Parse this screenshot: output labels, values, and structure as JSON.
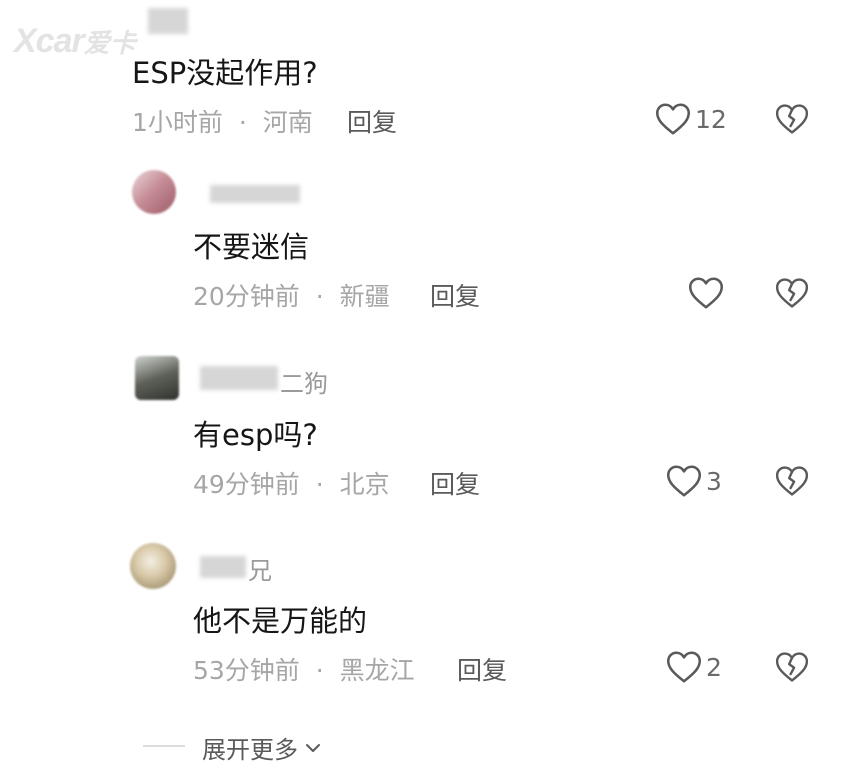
{
  "watermark": {
    "brand": "Xcar",
    "sub": "爱卡"
  },
  "top_comment": {
    "text": "ESP没起作用?",
    "time": "1小时前",
    "location": "河南",
    "reply_label": "回复",
    "likes": "12"
  },
  "replies": [
    {
      "username": "",
      "text": "不要迷信",
      "time": "20分钟前",
      "location": "新疆",
      "reply_label": "回复",
      "likes": ""
    },
    {
      "username": "二狗",
      "text": "有esp吗?",
      "time": "49分钟前",
      "location": "北京",
      "reply_label": "回复",
      "likes": "3"
    },
    {
      "username": "兄",
      "text": "他不是万能的",
      "time": "53分钟前",
      "location": "黑龙江",
      "reply_label": "回复",
      "likes": "2"
    }
  ],
  "meta_separator": "·",
  "expand": {
    "label": "展开更多"
  },
  "icons": {
    "like": "heart-outline-icon",
    "dislike": "broken-heart-icon",
    "expand": "chevron-down-icon"
  },
  "colors": {
    "text": "#161616",
    "meta": "#a6a6a6",
    "icon": "#5a5a5a"
  }
}
